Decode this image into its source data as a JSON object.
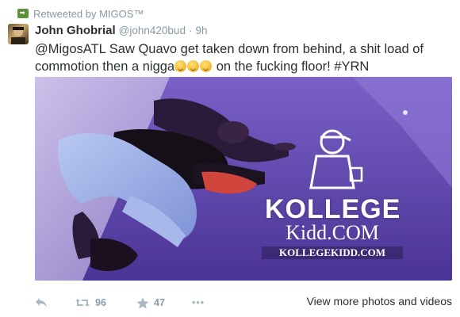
{
  "retweet": {
    "label": "Retweeted by MIGOS™"
  },
  "tweet": {
    "name": "John Ghobrial",
    "handle": "@john420bud",
    "separator": "·",
    "time": "9h",
    "text_part1": "@MigosATL Saw Quavo get taken down from behind, a shit load of commotion then a nigga",
    "text_part2": " on the fucking floor! #YRN",
    "emoji_count": 3
  },
  "photo": {
    "watermark_line1": "KOLLEGE",
    "watermark_line2": "Kidd.COM",
    "watermark_url": "KOLLEGEKIDD.COM"
  },
  "actions": {
    "retweet_count": "96",
    "favorite_count": "47",
    "more_label": "•••",
    "view_more": "View more photos and videos"
  },
  "colors": {
    "text": "#292f33",
    "muted": "#8899a6",
    "retweet_icon": "#5c913b",
    "photo_purple": "#6a4fbf"
  }
}
